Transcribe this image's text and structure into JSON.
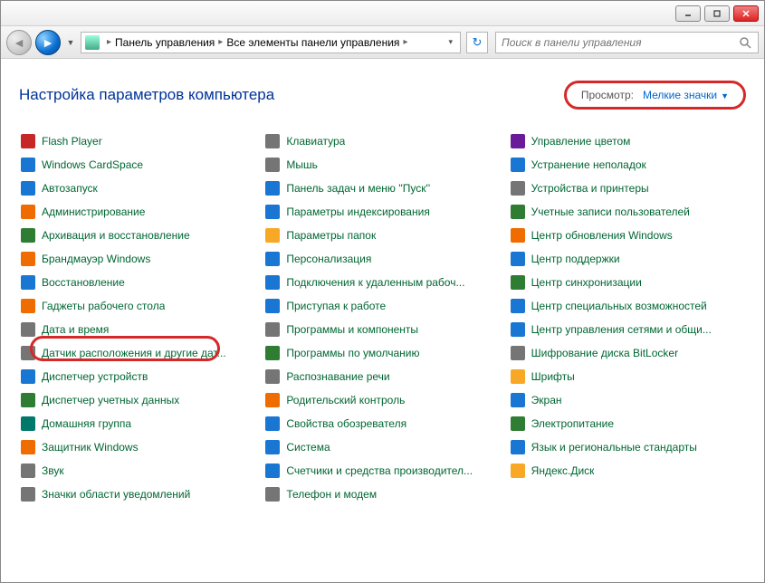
{
  "window": {
    "minimize_tooltip": "Свернуть",
    "maximize_tooltip": "Развернуть",
    "close_tooltip": "Закрыть"
  },
  "breadcrumb": {
    "root_icon": "control-panel-icon",
    "items": [
      "Панель управления",
      "Все элементы панели управления"
    ],
    "dropdown_glyph": "▾"
  },
  "nav": {
    "refresh_glyph": "↻"
  },
  "search": {
    "placeholder": "Поиск в панели управления"
  },
  "header": {
    "title": "Настройка параметров компьютера",
    "view_label": "Просмотр:",
    "view_value": "Мелкие значки"
  },
  "highlighted_item": "Программы и компоненты",
  "items": [
    {
      "label": "Flash Player",
      "icon": "flash-icon",
      "c": "c-red"
    },
    {
      "label": "Windows CardSpace",
      "icon": "cardspace-icon",
      "c": "c-blue"
    },
    {
      "label": "Автозапуск",
      "icon": "autoplay-icon",
      "c": "c-blue"
    },
    {
      "label": "Администрирование",
      "icon": "admin-tools-icon",
      "c": "c-orange"
    },
    {
      "label": "Архивация и восстановление",
      "icon": "backup-icon",
      "c": "c-green"
    },
    {
      "label": "Брандмауэр Windows",
      "icon": "firewall-icon",
      "c": "c-orange"
    },
    {
      "label": "Восстановление",
      "icon": "recovery-icon",
      "c": "c-blue"
    },
    {
      "label": "Гаджеты рабочего стола",
      "icon": "gadgets-icon",
      "c": "c-orange"
    },
    {
      "label": "Дата и время",
      "icon": "datetime-icon",
      "c": "c-grey"
    },
    {
      "label": "Датчик расположения и другие дат...",
      "icon": "sensor-icon",
      "c": "c-grey"
    },
    {
      "label": "Диспетчер устройств",
      "icon": "device-manager-icon",
      "c": "c-blue"
    },
    {
      "label": "Диспетчер учетных данных",
      "icon": "credential-manager-icon",
      "c": "c-green"
    },
    {
      "label": "Домашняя группа",
      "icon": "homegroup-icon",
      "c": "c-teal"
    },
    {
      "label": "Защитник Windows",
      "icon": "defender-icon",
      "c": "c-orange"
    },
    {
      "label": "Звук",
      "icon": "sound-icon",
      "c": "c-grey"
    },
    {
      "label": "Значки области уведомлений",
      "icon": "notification-icons-icon",
      "c": "c-grey"
    },
    {
      "label": "Клавиатура",
      "icon": "keyboard-icon",
      "c": "c-grey"
    },
    {
      "label": "Мышь",
      "icon": "mouse-icon",
      "c": "c-grey"
    },
    {
      "label": "Панель задач и меню ''Пуск''",
      "icon": "taskbar-icon",
      "c": "c-blue"
    },
    {
      "label": "Параметры индексирования",
      "icon": "indexing-icon",
      "c": "c-blue"
    },
    {
      "label": "Параметры папок",
      "icon": "folder-options-icon",
      "c": "c-yellow"
    },
    {
      "label": "Персонализация",
      "icon": "personalization-icon",
      "c": "c-blue"
    },
    {
      "label": "Подключения к удаленным рабоч...",
      "icon": "remote-desktop-icon",
      "c": "c-blue"
    },
    {
      "label": "Приступая к работе",
      "icon": "getting-started-icon",
      "c": "c-blue"
    },
    {
      "label": "Программы и компоненты",
      "icon": "programs-features-icon",
      "c": "c-grey"
    },
    {
      "label": "Программы по умолчанию",
      "icon": "default-programs-icon",
      "c": "c-green"
    },
    {
      "label": "Распознавание речи",
      "icon": "speech-icon",
      "c": "c-grey"
    },
    {
      "label": "Родительский контроль",
      "icon": "parental-controls-icon",
      "c": "c-orange"
    },
    {
      "label": "Свойства обозревателя",
      "icon": "internet-options-icon",
      "c": "c-blue"
    },
    {
      "label": "Система",
      "icon": "system-icon",
      "c": "c-blue"
    },
    {
      "label": "Счетчики и средства производител...",
      "icon": "performance-icon",
      "c": "c-blue"
    },
    {
      "label": "Телефон и модем",
      "icon": "phone-modem-icon",
      "c": "c-grey"
    },
    {
      "label": "Управление цветом",
      "icon": "color-management-icon",
      "c": "c-purple"
    },
    {
      "label": "Устранение неполадок",
      "icon": "troubleshooting-icon",
      "c": "c-blue"
    },
    {
      "label": "Устройства и принтеры",
      "icon": "devices-printers-icon",
      "c": "c-grey"
    },
    {
      "label": "Учетные записи пользователей",
      "icon": "user-accounts-icon",
      "c": "c-green"
    },
    {
      "label": "Центр обновления Windows",
      "icon": "windows-update-icon",
      "c": "c-orange"
    },
    {
      "label": "Центр поддержки",
      "icon": "action-center-icon",
      "c": "c-blue"
    },
    {
      "label": "Центр синхронизации",
      "icon": "sync-center-icon",
      "c": "c-green"
    },
    {
      "label": "Центр специальных возможностей",
      "icon": "ease-of-access-icon",
      "c": "c-blue"
    },
    {
      "label": "Центр управления сетями и общи...",
      "icon": "network-sharing-icon",
      "c": "c-blue"
    },
    {
      "label": "Шифрование диска BitLocker",
      "icon": "bitlocker-icon",
      "c": "c-grey"
    },
    {
      "label": "Шрифты",
      "icon": "fonts-icon",
      "c": "c-yellow"
    },
    {
      "label": "Экран",
      "icon": "display-icon",
      "c": "c-blue"
    },
    {
      "label": "Электропитание",
      "icon": "power-options-icon",
      "c": "c-green"
    },
    {
      "label": "Язык и региональные стандарты",
      "icon": "region-language-icon",
      "c": "c-blue"
    },
    {
      "label": "Яндекс.Диск",
      "icon": "yandex-disk-icon",
      "c": "c-yellow"
    }
  ]
}
